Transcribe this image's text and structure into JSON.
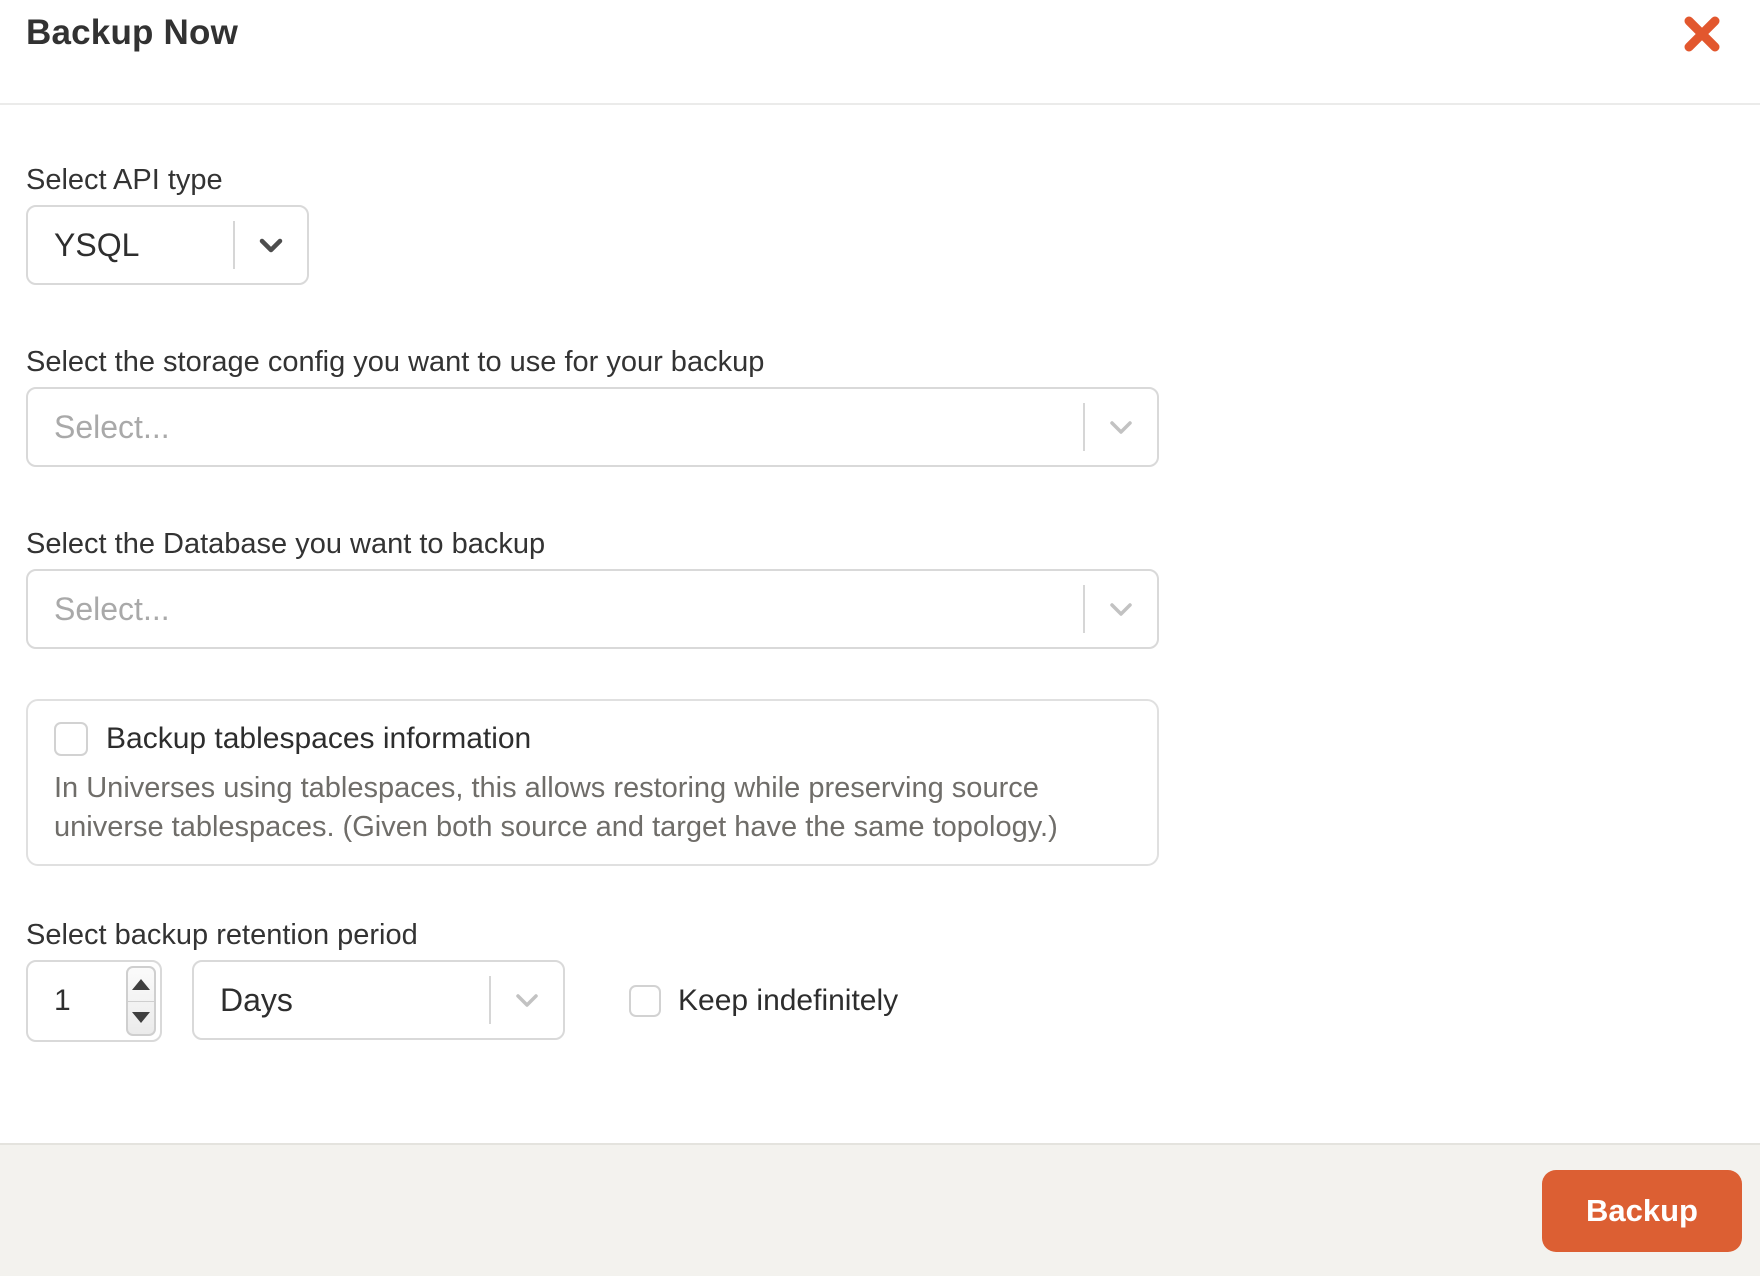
{
  "modal": {
    "title": "Backup Now"
  },
  "fields": {
    "api_type": {
      "label": "Select API type",
      "value": "YSQL"
    },
    "storage_config": {
      "label": "Select the storage config you want to use for your backup",
      "placeholder": "Select..."
    },
    "database": {
      "label": "Select the Database you want to backup",
      "placeholder": "Select..."
    },
    "tablespaces": {
      "label": "Backup tablespaces information",
      "checked": false,
      "description": "In Universes using tablespaces, this allows restoring while preserving source universe tablespaces. (Given both source and target have the same topology.)"
    },
    "retention": {
      "label": "Select backup retention period",
      "value": "1",
      "unit": "Days",
      "keep_label": "Keep indefinitely",
      "keep_checked": false
    }
  },
  "footer": {
    "backup_label": "Backup"
  },
  "colors": {
    "accent": "#dc5f33",
    "close_icon": "#e2572e",
    "footer_bg": "#f3f2ee"
  }
}
